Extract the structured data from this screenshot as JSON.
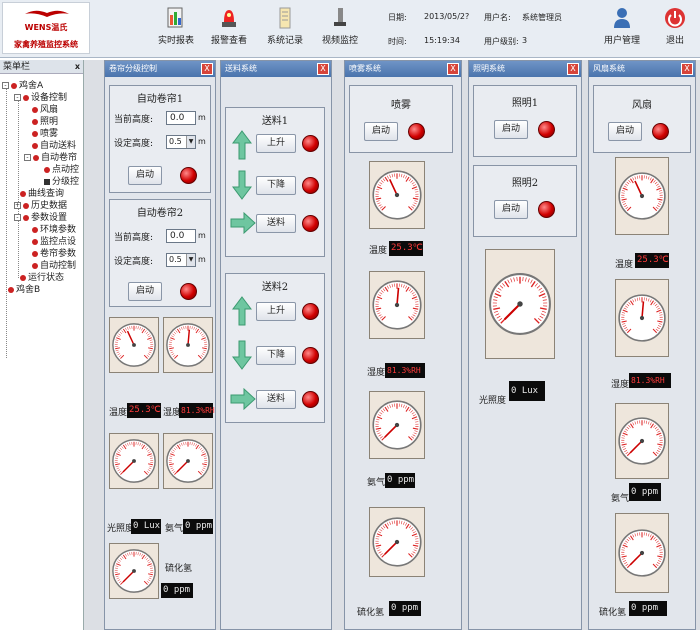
{
  "header": {
    "brand": "WENS温氏",
    "system_title": "家禽养殖监控系统",
    "toolbar": [
      {
        "label": "实时报表",
        "icon": "report-icon"
      },
      {
        "label": "报警查看",
        "icon": "alarm-icon"
      },
      {
        "label": "系统记录",
        "icon": "record-icon"
      },
      {
        "label": "视频监控",
        "icon": "video-icon"
      }
    ],
    "date_label": "日期:",
    "date_value": "2013/05/2?",
    "time_label": "时间:",
    "time_value": "15:19:34",
    "user_label": "用户名:",
    "user_value": "系统管理员",
    "level_label": "用户级别:",
    "level_value": "3",
    "user_mgmt": "用户管理",
    "exit": "退出"
  },
  "menu": {
    "title": "菜单栏",
    "close": "x",
    "items": [
      "鸡舍A",
      "设备控制",
      "风扇",
      "照明",
      "喷雾",
      "自动送料",
      "自动卷帘",
      "点动控",
      "分级控",
      "曲线查询",
      "历史数据",
      "参数设置",
      "环境参数",
      "监控点设",
      "卷帘参数",
      "自动控制",
      "运行状态",
      "鸡舍B"
    ]
  },
  "curtain": {
    "title": "卷帘分级控制",
    "g1": {
      "title": "自动卷帘1",
      "cur_label": "当前高度:",
      "cur_value": "0.0",
      "unit": "m",
      "set_label": "设定高度:",
      "set_value": "0.5",
      "start": "启动"
    },
    "g2": {
      "title": "自动卷帘2",
      "cur_label": "当前高度:",
      "cur_value": "0.0",
      "unit": "m",
      "set_label": "设定高度:",
      "set_value": "0.5",
      "start": "启动"
    },
    "readings": [
      {
        "label": "温度",
        "value": "25.3℃",
        "color": "#ff3b3b"
      },
      {
        "label": "湿度",
        "value": "81.3%RH",
        "color": "#ff3b3b"
      },
      {
        "label": "光照度",
        "value": "0 Lux",
        "color": "#e8e8e8"
      },
      {
        "label": "氨气",
        "value": "0 ppm",
        "color": "#e8e8e8"
      },
      {
        "label": "硫化氢",
        "value": "0 ppm",
        "color": "#e8e8e8"
      }
    ]
  },
  "feed": {
    "title": "送料系统",
    "g1": {
      "title": "送料1",
      "up": "上升",
      "down": "下降",
      "feed": "送料"
    },
    "g2": {
      "title": "送料2",
      "up": "上升",
      "down": "下降",
      "feed": "送料"
    }
  },
  "spray": {
    "title": "喷雾系统",
    "group": "喷雾",
    "start": "启动",
    "readings": [
      {
        "label": "温度",
        "value": "25.3℃",
        "color": "#ff3b3b"
      },
      {
        "label": "湿度",
        "value": "81.3%RH",
        "color": "#ff3b3b"
      },
      {
        "label": "氨气",
        "value": "0 ppm",
        "color": "#e8e8e8"
      },
      {
        "label": "硫化氢",
        "value": "0 ppm",
        "color": "#e8e8e8"
      }
    ]
  },
  "light": {
    "title": "照明系统",
    "g1": {
      "title": "照明1",
      "start": "启动"
    },
    "g2": {
      "title": "照明2",
      "start": "启动"
    },
    "reading": {
      "label": "光照度",
      "value": "0 Lux",
      "color": "#e8e8e8"
    }
  },
  "fan": {
    "title": "风扇系统",
    "group": "风扇",
    "start": "启动",
    "readings": [
      {
        "label": "温度",
        "value": "25.3℃",
        "color": "#ff3b3b"
      },
      {
        "label": "湿度",
        "value": "81.3%RH",
        "color": "#ff3b3b"
      },
      {
        "label": "氨气",
        "value": "0 ppm",
        "color": "#e8e8e8"
      },
      {
        "label": "硫化氢",
        "value": "0 ppm",
        "color": "#e8e8e8"
      }
    ]
  },
  "colors": {
    "led_on": "#d10000",
    "title_bar": "#4a74ad"
  }
}
